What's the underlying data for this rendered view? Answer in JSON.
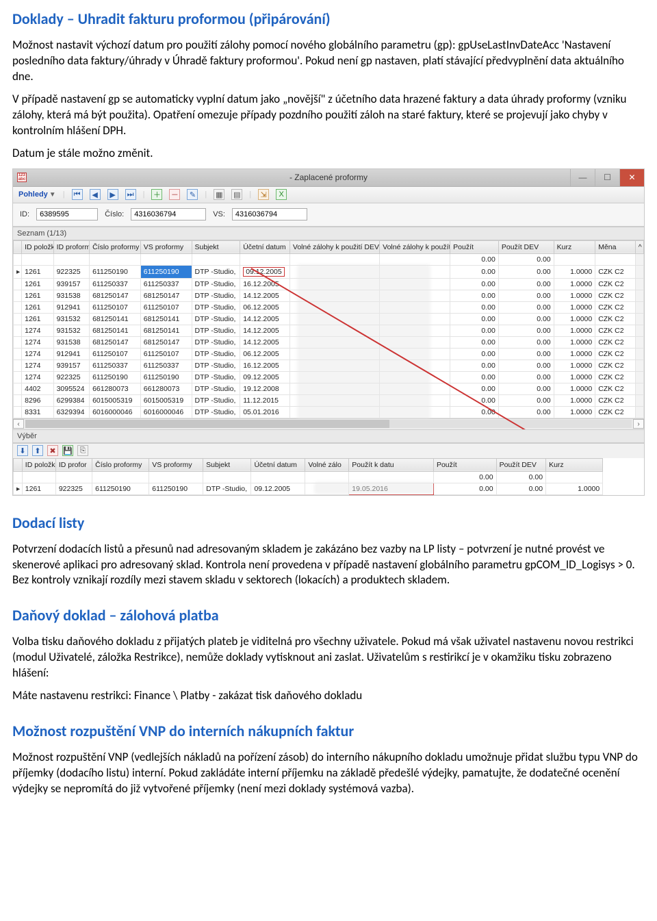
{
  "headings": {
    "h1": "Doklady – Uhradit fakturu proformou (připárování)",
    "h2": "Dodací listy",
    "h3": "Daňový doklad – zálohová platba",
    "h4": "Možnost rozpuštění VNP do interních nákupních faktur"
  },
  "paragraphs": {
    "p1": "Možnost nastavit výchozí datum pro použití zálohy pomocí nového globálního parametru (gp): gpUseLastInvDateAcc 'Nastavení posledního data faktury/úhrady v Úhradě faktury proformou'. Pokud není gp nastaven, platí stávající předvyplnění data aktuálního dne.",
    "p2": "V případě nastavení gp se automaticky vyplní datum jako „novější\" z účetního data hrazené faktury a data úhrady proformy (vzniku zálohy, která má být použita). Opatření omezuje případy pozdního použití záloh na staré faktury, které se projevují jako chyby v kontrolním hlášení DPH.",
    "p3": "Datum je stále možno změnit.",
    "p4": "Potvrzení dodacích listů a přesunů nad adresovaným skladem je zakázáno bez vazby na LP listy – potvrzení je nutné provést ve skenerové aplikaci pro adresovaný sklad. Kontrola není provedena v případě nastavení globálního parametru gpCOM_ID_Logisys > 0. Bez kontroly vznikají rozdíly mezi stavem skladu v sektorech (lokacích) a produktech skladem.",
    "p5": "Volba tisku daňového dokladu z přijatých plateb je viditelná pro všechny uživatele. Pokud má však uživatel nastavenu novou restrikci (modul Uživatelé, záložka Restrikce), nemůže doklady vytisknout ani zaslat. Uživatelům s restirikcí je v okamžiku tisku zobrazeno hlášení:",
    "p6": "Máte nastavenu restrikci: Finance \\ Platby - zakázat tisk daňového dokladu",
    "p7": "Možnost rozpuštění VNP (vedlejších nákladů na pořízení zásob) do interního nákupního dokladu umožnuje přidat službu typu VNP do příjemky (dodacího listu) interní. Pokud zakládáte interní příjemku na základě předešlé výdejky, pamatujte, že dodatečné ocenění výdejky se nepromítá do již vytvořené příjemky (není mezi doklady systémová vazba)."
  },
  "window": {
    "title": "- Zaplacené proformy",
    "app_icon_text": "123\nabc",
    "menu": {
      "pohledy": "Pohledy"
    },
    "filters": {
      "id_label": "ID:",
      "id_value": "6389595",
      "cislo_label": "Číslo:",
      "cislo_value": "4316036794",
      "vs_label": "VS:",
      "vs_value": "4316036794"
    },
    "seznam_label": "Seznam (1/13)",
    "columns_top": [
      "ID položk",
      "ID proform",
      "Číslo proformy",
      "VS proformy",
      "Subjekt",
      "Účetní datum",
      "Volné zálohy k použití DEV",
      "Volné zálohy k použít",
      "Použít",
      "Použít DEV",
      "Kurz",
      "Měna"
    ],
    "rows_top": [
      {
        "c": [
          "1261",
          "922325",
          "611250190",
          "611250190",
          "DTP -Studio,",
          "09.12.2005",
          "",
          "",
          "0.00",
          "0.00",
          "1.0000",
          "CZK C2"
        ],
        "hl": true
      },
      {
        "c": [
          "1261",
          "939157",
          "611250337",
          "611250337",
          "DTP -Studio,",
          "16.12.2005",
          "",
          "",
          "0.00",
          "0.00",
          "1.0000",
          "CZK C2"
        ]
      },
      {
        "c": [
          "1261",
          "931538",
          "681250147",
          "681250147",
          "DTP -Studio,",
          "14.12.2005",
          "",
          "",
          "0.00",
          "0.00",
          "1.0000",
          "CZK C2"
        ]
      },
      {
        "c": [
          "1261",
          "912941",
          "611250107",
          "611250107",
          "DTP -Studio,",
          "06.12.2005",
          "",
          "",
          "0.00",
          "0.00",
          "1.0000",
          "CZK C2"
        ]
      },
      {
        "c": [
          "1261",
          "931532",
          "681250141",
          "681250141",
          "DTP -Studio,",
          "14.12.2005",
          "",
          "",
          "0.00",
          "0.00",
          "1.0000",
          "CZK C2"
        ]
      },
      {
        "c": [
          "1274",
          "931532",
          "681250141",
          "681250141",
          "DTP -Studio,",
          "14.12.2005",
          "",
          "",
          "0.00",
          "0.00",
          "1.0000",
          "CZK C2"
        ]
      },
      {
        "c": [
          "1274",
          "931538",
          "681250147",
          "681250147",
          "DTP -Studio,",
          "14.12.2005",
          "",
          "",
          "0.00",
          "0.00",
          "1.0000",
          "CZK C2"
        ]
      },
      {
        "c": [
          "1274",
          "912941",
          "611250107",
          "611250107",
          "DTP -Studio,",
          "06.12.2005",
          "",
          "",
          "0.00",
          "0.00",
          "1.0000",
          "CZK C2"
        ]
      },
      {
        "c": [
          "1274",
          "939157",
          "611250337",
          "611250337",
          "DTP -Studio,",
          "16.12.2005",
          "",
          "",
          "0.00",
          "0.00",
          "1.0000",
          "CZK C2"
        ]
      },
      {
        "c": [
          "1274",
          "922325",
          "611250190",
          "611250190",
          "DTP -Studio,",
          "09.12.2005",
          "",
          "",
          "0.00",
          "0.00",
          "1.0000",
          "CZK C2"
        ]
      },
      {
        "c": [
          "4402",
          "3095524",
          "661280073",
          "661280073",
          "DTP -Studio,",
          "19.12.2008",
          "",
          "",
          "0.00",
          "0.00",
          "1.0000",
          "CZK C2"
        ]
      },
      {
        "c": [
          "8296",
          "6299384",
          "6015005319",
          "6015005319",
          "DTP -Studio,",
          "11.12.2015",
          "",
          "",
          "0.00",
          "0.00",
          "1.0000",
          "CZK C2"
        ]
      },
      {
        "c": [
          "8331",
          "6329394",
          "6016000046",
          "6016000046",
          "DTP -Studio,",
          "05.01.2016",
          "",
          "",
          "0.00",
          "0.00",
          "1.0000",
          "CZK C2"
        ]
      }
    ],
    "summary_top": {
      "pouzit": "0.00",
      "pouzit_dev": "0.00"
    },
    "vyber_label": "Výběr",
    "columns_bottom": [
      "ID položk",
      "ID profor",
      "Číslo proformy",
      "VS proformy",
      "Subjekt",
      "Účetní datum",
      "Volné zálo",
      "Použít k datu",
      "Použít",
      "Použít DEV",
      "Kurz"
    ],
    "row_bottom": {
      "c": [
        "1261",
        "922325",
        "611250190",
        "611250190",
        "DTP -Studio,",
        "09.12.2005",
        "",
        " ",
        "0.00",
        "0.00",
        "1.0000"
      ],
      "date": "19.05.2016"
    },
    "summary_bottom": {
      "pouzit": "0.00",
      "pouzit_dev": "0.00"
    }
  }
}
